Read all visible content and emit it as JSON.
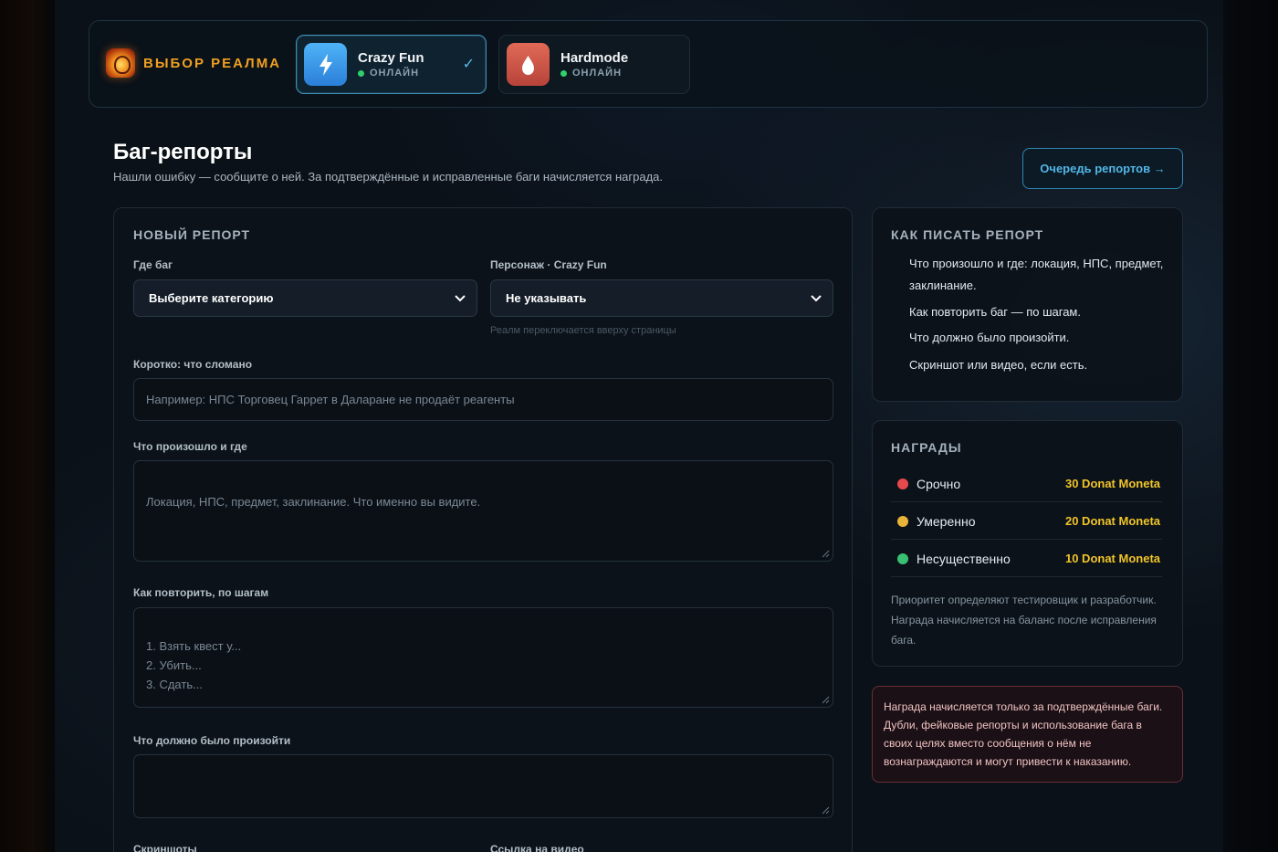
{
  "realm": {
    "title": "ВЫБОР РЕАЛМА",
    "realms": [
      {
        "name": "Crazy Fun",
        "status": "ОНЛАЙН",
        "selected": true,
        "icon": "lightning-icon",
        "accent": "#3d9bf0"
      },
      {
        "name": "Hardmode",
        "status": "ОНЛАЙН",
        "selected": false,
        "icon": "flame-drop-icon",
        "accent": "#cf5747"
      }
    ],
    "selected_check": "✓"
  },
  "header": {
    "title": "Баг-репорты",
    "subtitle": "Нашли ошибку — сообщите о ней. За подтверждённые и исправленные баги начисляется награда.",
    "queue_button": "Очередь репортов →"
  },
  "form": {
    "title": "НОВЫЙ РЕПОРТ",
    "category_label": "Где баг",
    "category_value": "Выберите категорию",
    "character_label": "Персонаж · Crazy Fun",
    "character_value": "Не указывать",
    "character_hint": "Реалм переключается вверху страницы",
    "summary_label": "Коротко: что сломано",
    "summary_placeholder": "Например: НПС Торговец Гаррет в Даларане не продаёт реагенты",
    "what_label": "Что произошло и где",
    "what_placeholder": "Локация, НПС, предмет, заклинание. Что именно вы видите.",
    "steps_label": "Как повторить, по шагам",
    "steps_placeholder": "1. Взять квест у...\n2. Убить...\n3. Сдать...",
    "expected_label": "Что должно было произойти",
    "expected_placeholder": "",
    "screenshots_label": "Скриншоты",
    "video_label": "Ссылка на видео"
  },
  "tips": {
    "title": "КАК ПИСАТЬ РЕПОРТ",
    "items": [
      "Что произошло и где: локация, НПС, предмет, заклинание.",
      "Как повторить баг — по шагам.",
      "Что должно было произойти.",
      "Скриншот или видео, если есть."
    ]
  },
  "rewards": {
    "title": "НАГРАДЫ",
    "items": [
      {
        "name": "Срочно",
        "value": "30 Donat Moneta",
        "color": "#e5484d"
      },
      {
        "name": "Умеренно",
        "value": "20 Donat Moneta",
        "color": "#e8b339"
      },
      {
        "name": "Несущественно",
        "value": "10 Donat Moneta",
        "color": "#38c172"
      }
    ],
    "note": "Приоритет определяют тестировщик и разработчик. Награда начисляется на баланс после исправления бага."
  },
  "warning": {
    "text": "Награда начисляется только за подтверждённые баги. Дубли, фейковые репорты и использование бага в своих целях вместо сообщения о нём не вознаграждаются и могут привести к наказанию."
  }
}
